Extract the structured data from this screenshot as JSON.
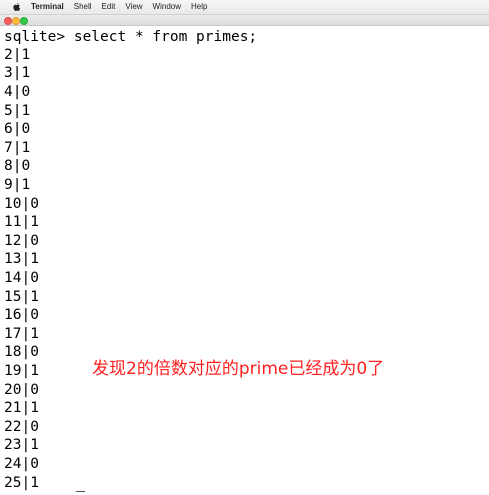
{
  "menubar": {
    "app_name": "Terminal",
    "items": [
      "Shell",
      "Edit",
      "View",
      "Window",
      "Help"
    ]
  },
  "terminal": {
    "command_line": "sqlite> select * from primes;",
    "rows": [
      "2|1",
      "3|1",
      "4|0",
      "5|1",
      "6|0",
      "7|1",
      "8|0",
      "9|1",
      "10|0",
      "11|1",
      "12|0",
      "13|1",
      "14|0",
      "15|1",
      "16|0",
      "17|1",
      "18|0",
      "19|1",
      "20|0",
      "21|1",
      "22|0",
      "23|1",
      "24|0",
      "25|1"
    ]
  },
  "annotation": {
    "text": "发现2的倍数对应的prime已经成为0了",
    "color": "#ff2020"
  }
}
